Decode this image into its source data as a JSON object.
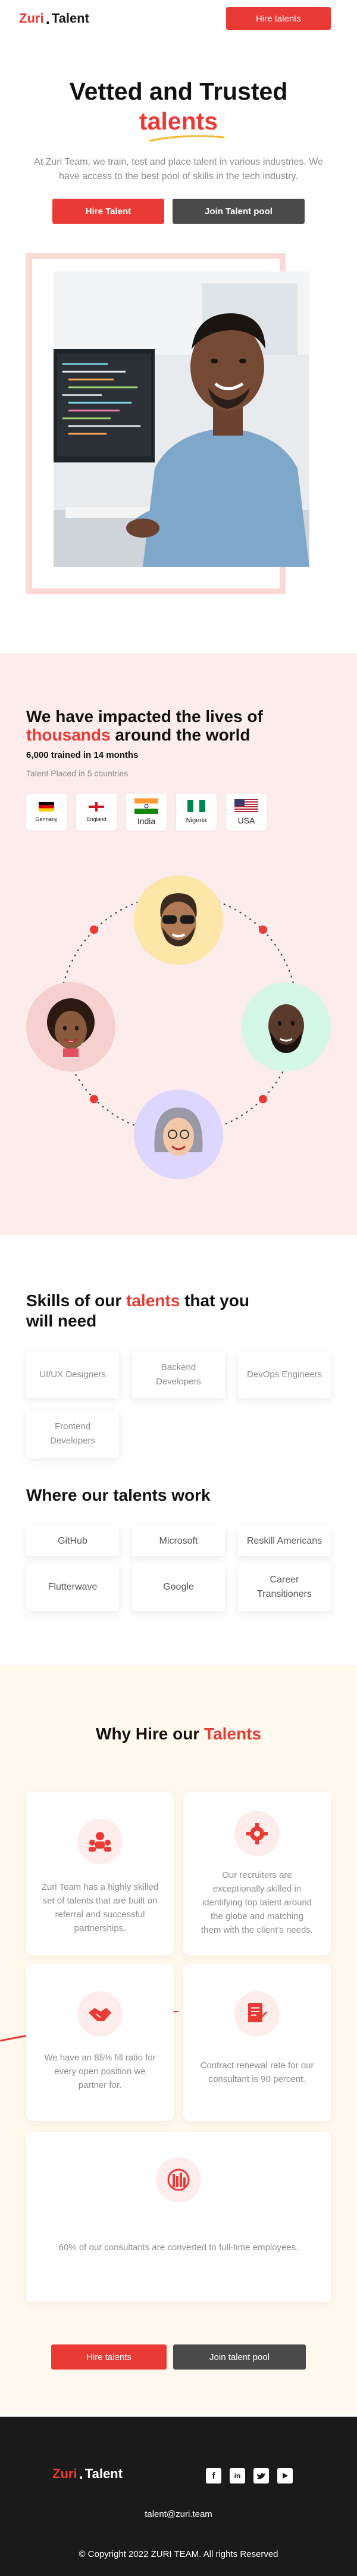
{
  "nav": {
    "logo_part1": "Zuri",
    "logo_dot": ".",
    "logo_part2": "Talent",
    "cta": "Hire talents"
  },
  "hero": {
    "title_line1": "Vetted and Trusted",
    "title_highlight": "talents",
    "subtitle": "At Zuri Team, we train, test and place talent in various industries. We have access to the best pool of skills in the tech industry.",
    "primary_btn": "Hire Talent",
    "secondary_btn": "Join Talent pool"
  },
  "impact": {
    "title_part1": "We have impacted the lives of",
    "title_highlight": "thousands",
    "title_part2": "around the world",
    "stat": "6,000 trained in 14 months",
    "placed": "Talent Placed in 5 countries",
    "countries": [
      {
        "name": "Germany"
      },
      {
        "name": "England"
      },
      {
        "name": "India"
      },
      {
        "name": "Nigeria"
      },
      {
        "name": "USA"
      }
    ]
  },
  "skills": {
    "title_part1": "Skills of our",
    "title_highlight": "talents",
    "title_part2": "that you will need",
    "items": [
      "UI/UX Designers",
      "Backend Developers",
      "DevOps Engineers",
      "Frontend Developers"
    ]
  },
  "work": {
    "title": "Where our talents work",
    "items": [
      "GitHub",
      "Microsoft",
      "Reskill Americans",
      "Flutterwave",
      "Google",
      "Career Transitioners"
    ]
  },
  "why": {
    "title_part1": "Why Hire our",
    "title_highlight": "Talents",
    "cards": [
      "Zuri Team has a highly skilled set of talents that are built on referral and successful partnerships.",
      "Our recruiters are exceptionally skilled in identifying top talent around the globe and matching them with the client's needs.",
      "We have an 85% fill ratio for every open position we partner for.",
      "Contract renewal rate for our consultant is 90 percent.",
      "60% of our consultants are converted to full-time employees."
    ],
    "primary_btn": "Hire talents",
    "secondary_btn": "Join talent pool"
  },
  "footer": {
    "logo_part1": "Zuri",
    "logo_dot": ".",
    "logo_part2": "Talent",
    "email": "talent@zuri.team",
    "copyright": "© Copyright 2022 ZURI TEAM. All rights Reserved"
  },
  "colors": {
    "accent": "#e93a35",
    "dark_button": "#4a4a4a",
    "pink_bg": "#fdecec",
    "cream_bg": "#fff8ec",
    "footer_bg": "#1a1a1a"
  }
}
